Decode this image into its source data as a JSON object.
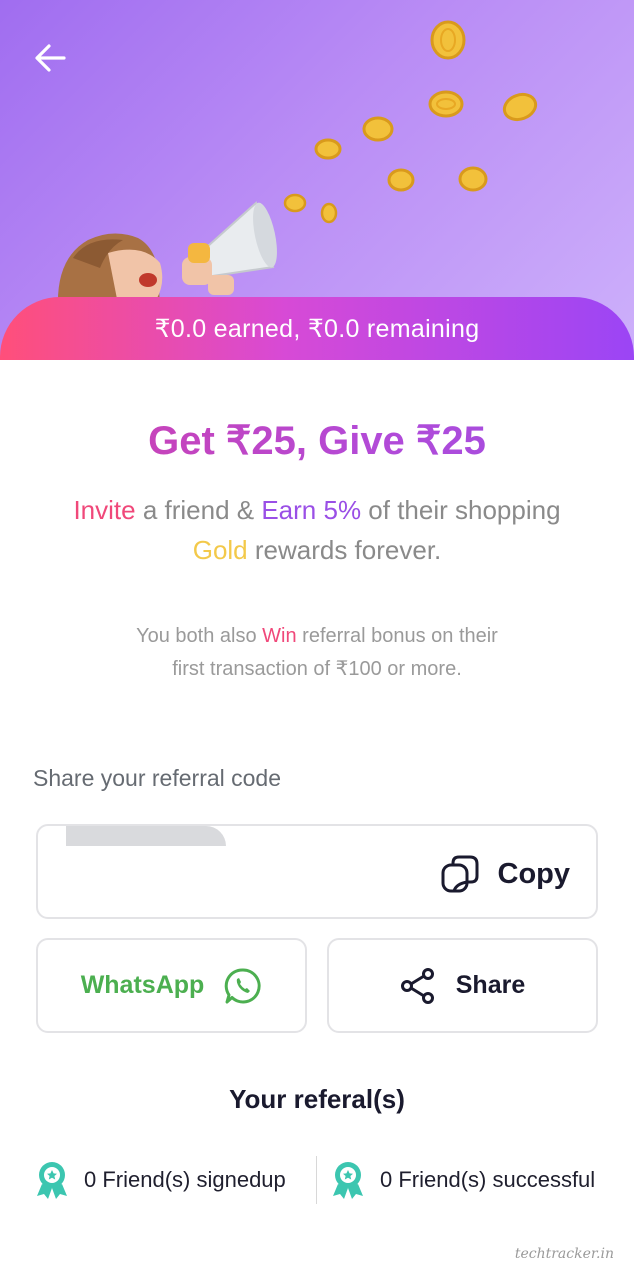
{
  "header": {
    "back_icon": "arrow-left-icon",
    "earnings_banner": "₹0.0 earned, ₹0.0 remaining"
  },
  "promo": {
    "headline": "Get ₹25, Give ₹25",
    "invite_word": "Invite",
    "invite_mid": " a friend & ",
    "earn_word": "Earn 5%",
    "invite_tail": " of their shopping",
    "gold_word": "Gold",
    "gold_tail": " rewards forever.",
    "bonus_prefix": "You both also ",
    "bonus_win": "Win",
    "bonus_suffix": " referral bonus on their",
    "bonus_line2": "first transaction of ₹100 or more."
  },
  "referral_code": {
    "label": "Share your referral code",
    "copy_label": "Copy",
    "copy_icon": "copy-icon"
  },
  "share_actions": {
    "whatsapp_label": "WhatsApp",
    "whatsapp_icon": "whatsapp-icon",
    "share_label": "Share",
    "share_icon": "share-icon"
  },
  "referrals": {
    "title": "Your referal(s)",
    "signedup": "0 Friend(s) signedup",
    "successful": "0 Friend(s) successful",
    "badge_icon": "award-badge-icon"
  },
  "colors": {
    "pink": "#f0487a",
    "purple": "#9a4fe6",
    "gold": "#f3c94a",
    "whatsapp_green": "#4caf50",
    "badge_teal": "#3cc6b0"
  }
}
